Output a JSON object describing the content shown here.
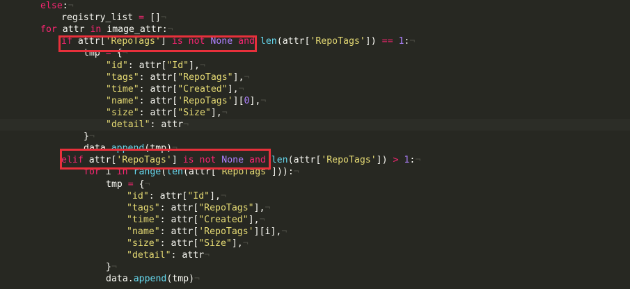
{
  "editor": {
    "lines": [
      {
        "segments": [
          {
            "t": "else",
            "c": "kw"
          },
          {
            "t": ":",
            "c": "pl"
          }
        ]
      },
      {
        "indent": 1,
        "segments": [
          {
            "t": "registry_list",
            "c": "pl"
          },
          {
            "t": " = ",
            "c": "op"
          },
          {
            "t": "[]",
            "c": "pl"
          }
        ]
      },
      {
        "segments": [
          {
            "t": "for",
            "c": "kw"
          },
          {
            "t": " attr ",
            "c": "pl"
          },
          {
            "t": "in",
            "c": "kw"
          },
          {
            "t": " image_attr:",
            "c": "pl"
          }
        ]
      },
      {
        "indent": 1,
        "segments": [
          {
            "t": "if",
            "c": "kw"
          },
          {
            "t": " attr[",
            "c": "pl"
          },
          {
            "t": "'RepoTags'",
            "c": "str"
          },
          {
            "t": "] ",
            "c": "pl"
          },
          {
            "t": "is not",
            "c": "kw"
          },
          {
            "t": " ",
            "c": "pl"
          },
          {
            "t": "None",
            "c": "cst"
          },
          {
            "t": " ",
            "c": "pl"
          },
          {
            "t": "and",
            "c": "kw"
          },
          {
            "t": " ",
            "c": "pl"
          },
          {
            "t": "len",
            "c": "fn"
          },
          {
            "t": "(attr[",
            "c": "pl"
          },
          {
            "t": "'RepoTags'",
            "c": "str"
          },
          {
            "t": "]) ",
            "c": "pl"
          },
          {
            "t": "==",
            "c": "op"
          },
          {
            "t": " ",
            "c": "pl"
          },
          {
            "t": "1",
            "c": "num"
          },
          {
            "t": ":",
            "c": "pl"
          }
        ]
      },
      {
        "indent": 2,
        "segments": [
          {
            "t": "tmp",
            "c": "pl"
          },
          {
            "t": " = ",
            "c": "op"
          },
          {
            "t": "{",
            "c": "pl"
          }
        ]
      },
      {
        "indent": 3,
        "segments": [
          {
            "t": "\"id\"",
            "c": "str"
          },
          {
            "t": ": attr[",
            "c": "pl"
          },
          {
            "t": "\"Id\"",
            "c": "str"
          },
          {
            "t": "],",
            "c": "pl"
          }
        ]
      },
      {
        "indent": 3,
        "segments": [
          {
            "t": "\"tags\"",
            "c": "str"
          },
          {
            "t": ": attr[",
            "c": "pl"
          },
          {
            "t": "\"RepoTags\"",
            "c": "str"
          },
          {
            "t": "],",
            "c": "pl"
          }
        ]
      },
      {
        "indent": 3,
        "segments": [
          {
            "t": "\"time\"",
            "c": "str"
          },
          {
            "t": ": attr[",
            "c": "pl"
          },
          {
            "t": "\"Created\"",
            "c": "str"
          },
          {
            "t": "],",
            "c": "pl"
          }
        ]
      },
      {
        "indent": 3,
        "segments": [
          {
            "t": "\"name\"",
            "c": "str"
          },
          {
            "t": ": attr[",
            "c": "pl"
          },
          {
            "t": "'RepoTags'",
            "c": "str"
          },
          {
            "t": "][",
            "c": "pl"
          },
          {
            "t": "0",
            "c": "num"
          },
          {
            "t": "],",
            "c": "pl"
          }
        ]
      },
      {
        "indent": 3,
        "segments": [
          {
            "t": "\"size\"",
            "c": "str"
          },
          {
            "t": ": attr[",
            "c": "pl"
          },
          {
            "t": "\"Size\"",
            "c": "str"
          },
          {
            "t": "],",
            "c": "pl"
          }
        ]
      },
      {
        "indent": 3,
        "current": true,
        "segments": [
          {
            "t": "\"detail\"",
            "c": "str"
          },
          {
            "t": ": attr",
            "c": "pl"
          }
        ]
      },
      {
        "indent": 2,
        "segments": [
          {
            "t": "}",
            "c": "pl"
          }
        ]
      },
      {
        "indent": 2,
        "segments": [
          {
            "t": "data.",
            "c": "pl"
          },
          {
            "t": "append",
            "c": "fn"
          },
          {
            "t": "(tmp)",
            "c": "pl"
          }
        ]
      },
      {
        "indent": 1,
        "segments": [
          {
            "t": "elif",
            "c": "kw"
          },
          {
            "t": " attr[",
            "c": "pl"
          },
          {
            "t": "'RepoTags'",
            "c": "str"
          },
          {
            "t": "] ",
            "c": "pl"
          },
          {
            "t": "is not",
            "c": "kw"
          },
          {
            "t": " ",
            "c": "pl"
          },
          {
            "t": "None",
            "c": "cst"
          },
          {
            "t": " ",
            "c": "pl"
          },
          {
            "t": "and",
            "c": "kw"
          },
          {
            "t": " ",
            "c": "pl"
          },
          {
            "t": "len",
            "c": "fn"
          },
          {
            "t": "(attr[",
            "c": "pl"
          },
          {
            "t": "'RepoTags'",
            "c": "str"
          },
          {
            "t": "]) ",
            "c": "pl"
          },
          {
            "t": ">",
            "c": "op"
          },
          {
            "t": " ",
            "c": "pl"
          },
          {
            "t": "1",
            "c": "num"
          },
          {
            "t": ":",
            "c": "pl"
          }
        ]
      },
      {
        "indent": 2,
        "segments": [
          {
            "t": "for",
            "c": "kw"
          },
          {
            "t": " i ",
            "c": "pl"
          },
          {
            "t": "in",
            "c": "kw"
          },
          {
            "t": " ",
            "c": "pl"
          },
          {
            "t": "range",
            "c": "fn"
          },
          {
            "t": "(",
            "c": "pl"
          },
          {
            "t": "len",
            "c": "fn"
          },
          {
            "t": "(attr[",
            "c": "pl"
          },
          {
            "t": "'RepoTags'",
            "c": "str"
          },
          {
            "t": "])):",
            "c": "pl"
          }
        ]
      },
      {
        "indent": 3,
        "segments": [
          {
            "t": "tmp",
            "c": "pl"
          },
          {
            "t": " = ",
            "c": "op"
          },
          {
            "t": "{",
            "c": "pl"
          }
        ]
      },
      {
        "indent": 4,
        "segments": [
          {
            "t": "\"id\"",
            "c": "str"
          },
          {
            "t": ": attr[",
            "c": "pl"
          },
          {
            "t": "\"Id\"",
            "c": "str"
          },
          {
            "t": "],",
            "c": "pl"
          }
        ]
      },
      {
        "indent": 4,
        "segments": [
          {
            "t": "\"tags\"",
            "c": "str"
          },
          {
            "t": ": attr[",
            "c": "pl"
          },
          {
            "t": "\"RepoTags\"",
            "c": "str"
          },
          {
            "t": "],",
            "c": "pl"
          }
        ]
      },
      {
        "indent": 4,
        "segments": [
          {
            "t": "\"time\"",
            "c": "str"
          },
          {
            "t": ": attr[",
            "c": "pl"
          },
          {
            "t": "\"Created\"",
            "c": "str"
          },
          {
            "t": "],",
            "c": "pl"
          }
        ]
      },
      {
        "indent": 4,
        "segments": [
          {
            "t": "\"name\"",
            "c": "str"
          },
          {
            "t": ": attr[",
            "c": "pl"
          },
          {
            "t": "'RepoTags'",
            "c": "str"
          },
          {
            "t": "][i],",
            "c": "pl"
          }
        ]
      },
      {
        "indent": 4,
        "segments": [
          {
            "t": "\"size\"",
            "c": "str"
          },
          {
            "t": ": attr[",
            "c": "pl"
          },
          {
            "t": "\"Size\"",
            "c": "str"
          },
          {
            "t": "],",
            "c": "pl"
          }
        ]
      },
      {
        "indent": 4,
        "segments": [
          {
            "t": "\"detail\"",
            "c": "str"
          },
          {
            "t": ": attr",
            "c": "pl"
          }
        ]
      },
      {
        "indent": 3,
        "segments": [
          {
            "t": "}",
            "c": "pl"
          }
        ]
      },
      {
        "indent": 3,
        "segments": [
          {
            "t": "data.",
            "c": "pl"
          },
          {
            "t": "append",
            "c": "fn"
          },
          {
            "t": "(tmp)",
            "c": "pl"
          }
        ]
      }
    ]
  },
  "colors": {
    "background": "#272822",
    "keyword": "#f92672",
    "string": "#e6db74",
    "number": "#ae81ff",
    "function": "#66d9ef",
    "plain": "#f8f8f2",
    "annotation_box": "#e8303b"
  }
}
